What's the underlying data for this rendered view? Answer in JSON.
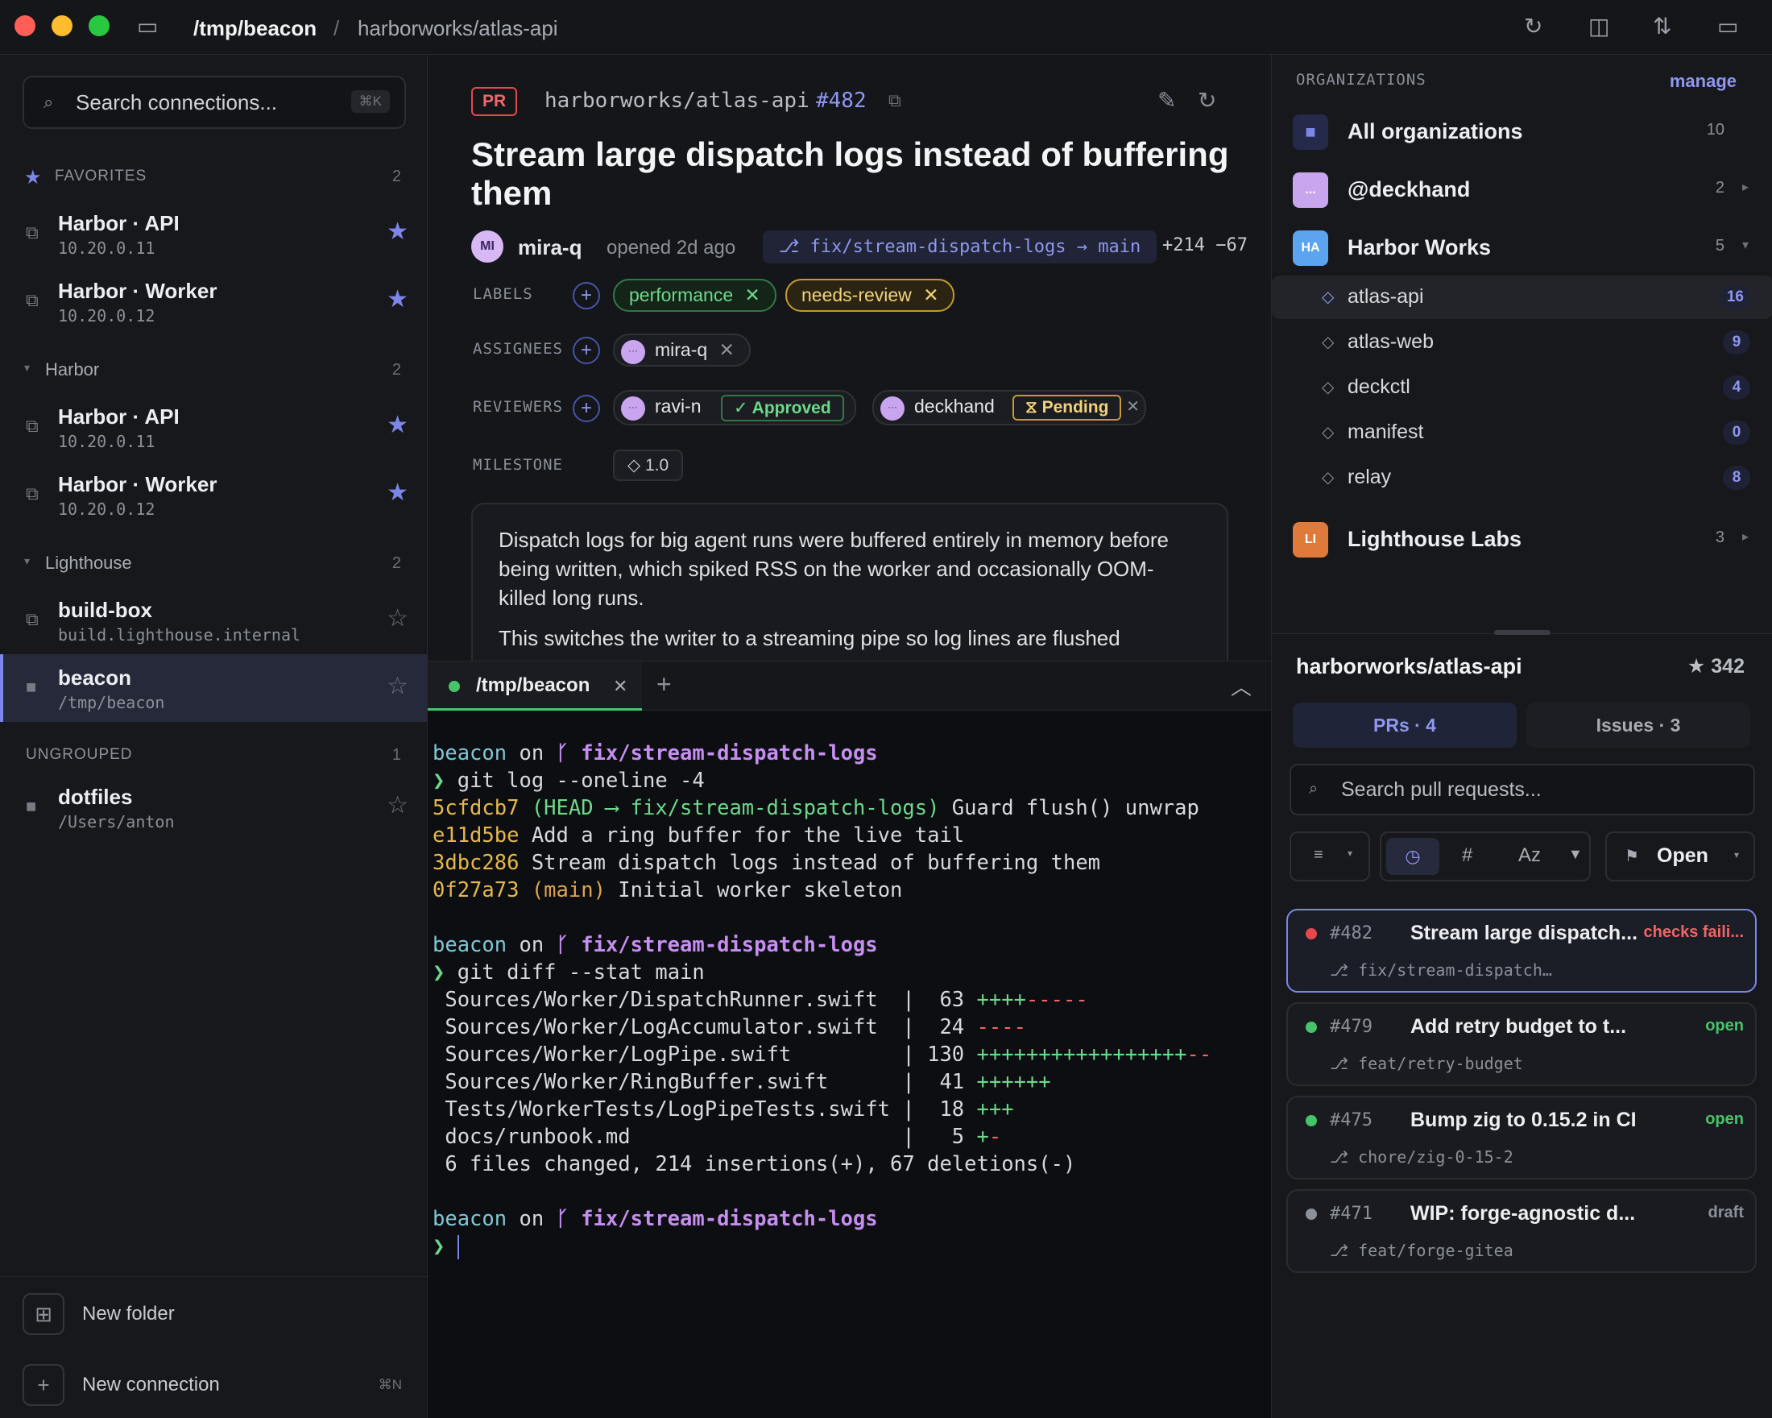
{
  "titlebar": {
    "path": "/tmp/beacon",
    "separator": "/",
    "repo": "harborworks/atlas-api"
  },
  "sidebar": {
    "search_placeholder": "Search connections...",
    "search_shortcut": "⌘K",
    "favorites": {
      "label": "FAVORITES",
      "count": "2",
      "items": [
        {
          "name": "Harbor · API",
          "addr": "10.20.0.11",
          "starred": true
        },
        {
          "name": "Harbor · Worker",
          "addr": "10.20.0.12",
          "starred": true
        }
      ]
    },
    "harbor": {
      "label": "Harbor",
      "count": "2",
      "items": [
        {
          "name": "Harbor · API",
          "addr": "10.20.0.11",
          "starred": true
        },
        {
          "name": "Harbor · Worker",
          "addr": "10.20.0.12",
          "starred": true
        }
      ]
    },
    "lighthouse": {
      "label": "Lighthouse",
      "count": "2",
      "items": [
        {
          "name": "build-box",
          "addr": "build.lighthouse.internal",
          "starred": false
        },
        {
          "name": "beacon",
          "addr": "/tmp/beacon",
          "starred": false
        }
      ]
    },
    "ungrouped": {
      "label": "UNGROUPED",
      "count": "1",
      "items": [
        {
          "name": "dotfiles",
          "addr": "/Users/anton",
          "starred": false
        }
      ]
    },
    "new_folder": "New folder",
    "new_connection": "New connection",
    "new_connection_shortcut": "⌘N"
  },
  "pr": {
    "badge": "PR",
    "repo": "harborworks/atlas-api",
    "number": "#482",
    "title": "Stream large dispatch logs instead of buffering them",
    "author_initials": "MI",
    "author": "mira-q",
    "opened": "opened 2d ago",
    "branch": "⎇ fix/stream-dispatch-logs → main",
    "diffstat": "+214 −67",
    "labels_label": "LABELS",
    "labels": [
      "performance",
      "needs-review"
    ],
    "assignees_label": "ASSIGNEES",
    "assignee": "mira-q",
    "reviewers_label": "REVIEWERS",
    "reviewers": [
      {
        "name": "ravi-n",
        "status": "✓ Approved"
      },
      {
        "name": "deckhand",
        "status": "⧖ Pending"
      }
    ],
    "milestone_label": "MILESTONE",
    "milestone": "◇ 1.0",
    "body": [
      "Dispatch logs for big agent runs were buffered entirely in memory before being written, which spiked RSS on the worker and occasionally OOM-killed long runs.",
      "This switches the writer to a streaming pipe so log lines are flushed"
    ]
  },
  "terminal": {
    "tab_label": "/tmp/beacon",
    "prompt_dir": "beacon",
    "prompt_on": " on ",
    "prompt_branch": "ᚴ fix/stream-dispatch-logs",
    "prompt_char": "❯",
    "cmd1": " git log --oneline -4",
    "log": [
      {
        "hash": "5cfdcb7",
        "ref": " (HEAD ⟶ fix/stream-dispatch-logs)",
        "msg": " Guard flush() unwrap"
      },
      {
        "hash": "e11d5be",
        "ref": "",
        "msg": " Add a ring buffer for the live tail"
      },
      {
        "hash": "3dbc286",
        "ref": "",
        "msg": " Stream dispatch logs instead of buffering them"
      },
      {
        "hash": "0f27a73",
        "ref": " (main)",
        "msg": " Initial worker skeleton"
      }
    ],
    "cmd2": " git diff --stat main",
    "stat": [
      {
        "file": " Sources/Worker/DispatchRunner.swift  |  63 ",
        "plus": "++++",
        "minus": "-----"
      },
      {
        "file": " Sources/Worker/LogAccumulator.swift  |  24 ",
        "plus": "",
        "minus": "----"
      },
      {
        "file": " Sources/Worker/LogPipe.swift         | 130 ",
        "plus": "+++++++++++++++++",
        "minus": "--"
      },
      {
        "file": " Sources/Worker/RingBuffer.swift      |  41 ",
        "plus": "++++++",
        "minus": ""
      },
      {
        "file": " Tests/WorkerTests/LogPipeTests.swift |  18 ",
        "plus": "+++",
        "minus": ""
      },
      {
        "file": " docs/runbook.md                      |   5 ",
        "plus": "+",
        "minus": "-"
      }
    ],
    "summary": " 6 files changed, 214 insertions(+), 67 deletions(-)"
  },
  "right": {
    "orgs_label": "ORGANIZATIONS",
    "manage": "manage",
    "orgs": [
      {
        "initials": "",
        "name": "All organizations",
        "count": "10"
      },
      {
        "initials": "...",
        "name": "@deckhand",
        "count": "2"
      },
      {
        "initials": "HA",
        "name": "Harbor Works",
        "count": "5"
      },
      {
        "initials": "LI",
        "name": "Lighthouse Labs",
        "count": "3"
      }
    ],
    "repos": [
      {
        "name": "atlas-api",
        "count": "16"
      },
      {
        "name": "atlas-web",
        "count": "9"
      },
      {
        "name": "deckctl",
        "count": "4"
      },
      {
        "name": "manifest",
        "count": "0"
      },
      {
        "name": "relay",
        "count": "8"
      }
    ],
    "repo_title": "harborworks/atlas-api",
    "stars": "★ 342",
    "tab_prs": "PRs · 4",
    "tab_issues": "Issues · 3",
    "search_placeholder": "Search pull requests...",
    "sort_labels": [
      "#",
      "Az"
    ],
    "filter_state": "Open",
    "prs": [
      {
        "num": "#482",
        "title": "Stream large dispatch...",
        "state": "checks faili...",
        "branch": "⎇ fix/stream-dispatch…",
        "color": "#e5484d"
      },
      {
        "num": "#479",
        "title": "Add retry budget to t...",
        "state": "open",
        "branch": "⎇ feat/retry-budget",
        "color": "#46c46a"
      },
      {
        "num": "#475",
        "title": "Bump zig to 0.15.2 in CI",
        "state": "open",
        "branch": "⎇ chore/zig-0-15-2",
        "color": "#46c46a"
      },
      {
        "num": "#471",
        "title": "WIP: forge-agnostic d...",
        "state": "draft",
        "branch": "⎇ feat/forge-gitea",
        "color": "#8b9099"
      }
    ]
  },
  "colors": {
    "accent": "#7c86e8",
    "green": "#46c46a",
    "red": "#e5484d",
    "yellow": "#e5b84b"
  }
}
